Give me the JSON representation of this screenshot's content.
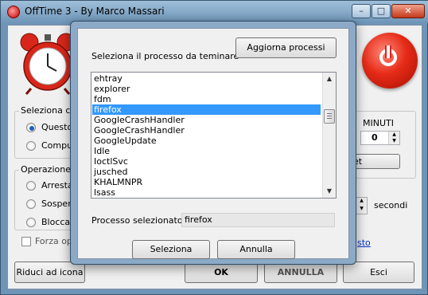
{
  "window": {
    "title": "OffTime 3 - By Marco Massari"
  },
  "caption_buttons": {
    "minimize": "–",
    "maximize": "□",
    "close": "✕"
  },
  "main": {
    "group_select_label": "Seleziona comp",
    "radio_select_1": "Questo co",
    "radio_select_2": "Computer",
    "minuti_label": "MINUTI",
    "minuti_value": "0",
    "reset_button": "et",
    "group_operation_label": "Operazione",
    "op_radio_1": "Arresta il s",
    "op_radio_2": "Sospendi",
    "op_radio_3": "Blocca sis",
    "secondi_label": "secondi",
    "force_checkbox": "Forza opera",
    "link_text": "sto",
    "buttons": {
      "tray": "Riduci ad icona",
      "ok": "OK",
      "cancel": "ANNULLA",
      "exit": "Esci"
    }
  },
  "dialog": {
    "prompt": "Seleziona il processo da teminare",
    "refresh_button": "Aggiorna processi",
    "processes": [
      "ehtray",
      "explorer",
      "fdm",
      "firefox",
      "GoogleCrashHandler",
      "GoogleCrashHandler",
      "GoogleUpdate",
      "Idle",
      "IoctlSvc",
      "jusched",
      "KHALMNPR",
      "lsass"
    ],
    "selected_index": 3,
    "selected_label": "Processo selezionato:",
    "selected_value": "firefox",
    "select_button": "Seleziona",
    "cancel_button": "Annulla"
  },
  "icons": {
    "app": "alarm-clock-icon",
    "clock": "alarm-clock-icon",
    "power": "power-icon"
  },
  "colors": {
    "selection": "#3399ff",
    "power_red": "#e52b17",
    "title_bar": "#8fb1cf"
  }
}
